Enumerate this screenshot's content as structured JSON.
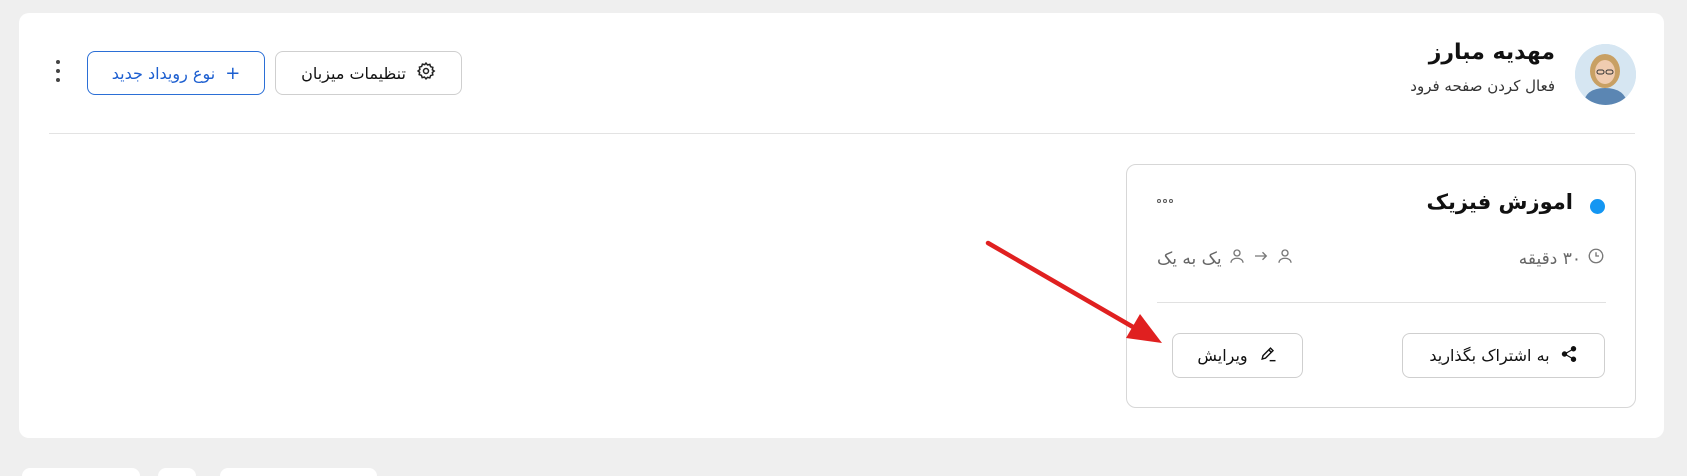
{
  "header": {
    "user_name": "مهدیه مبارز",
    "user_subtitle": "فعال کردن صفحه فرود",
    "host_settings_label": "تنظیمات میزبان",
    "new_event_type_label": "نوع رویداد جدید",
    "new_event_plus": "+"
  },
  "event_card": {
    "title": "اموزش فیزیک",
    "duration": "۳۰ دقیقه",
    "meeting_type": "یک به یک",
    "share_label": "به اشتراک بگذارید",
    "edit_label": "ویرایش",
    "accent_color": "#1496f2"
  },
  "icons": [
    "avatar",
    "gear-icon",
    "plus-icon",
    "kebab-icon",
    "more-dots-icon",
    "clock-icon",
    "user-icon",
    "arrow-right-icon",
    "share-icon",
    "pencil-icon"
  ],
  "colors": {
    "primary": "#1d5fd0",
    "annotation_arrow": "#e02020"
  }
}
